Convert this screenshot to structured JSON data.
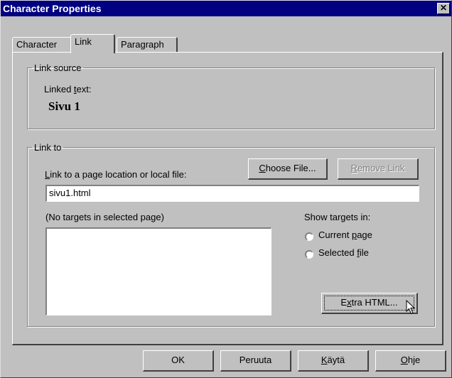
{
  "window": {
    "title": "Character Properties",
    "close_glyph": "✕"
  },
  "tabs": [
    {
      "label": "Character",
      "active": false
    },
    {
      "label": "Link",
      "active": true
    },
    {
      "label": "Paragraph",
      "active": false
    }
  ],
  "link_source": {
    "legend": "Link source",
    "linked_text_label_pre": "Linked ",
    "linked_text_label_u": "t",
    "linked_text_label_post": "ext:",
    "linked_text_value": "Sivu 1"
  },
  "link_to": {
    "legend": "Link to",
    "field_label_u": "L",
    "field_label_post": "ink to a page location or local file:",
    "choose_file_u": "C",
    "choose_file_post": "hoose File...",
    "remove_link_u": "R",
    "remove_link_post": "emove Link",
    "url_value": "sivu1.html",
    "targets_label": "(No targets in selected page)",
    "show_targets_label": "Show targets in:",
    "radio_current_pre": "Current ",
    "radio_current_u": "p",
    "radio_current_post": "age",
    "radio_selected_pre": "Selected ",
    "radio_selected_u": "f",
    "radio_selected_post": "ile",
    "extra_html_pre": "E",
    "extra_html_u": "x",
    "extra_html_post": "tra HTML..."
  },
  "footer": {
    "ok": "OK",
    "cancel": "Peruuta",
    "apply_u": "K",
    "apply_post": "äytä",
    "help_u": "O",
    "help_post": "hje"
  }
}
